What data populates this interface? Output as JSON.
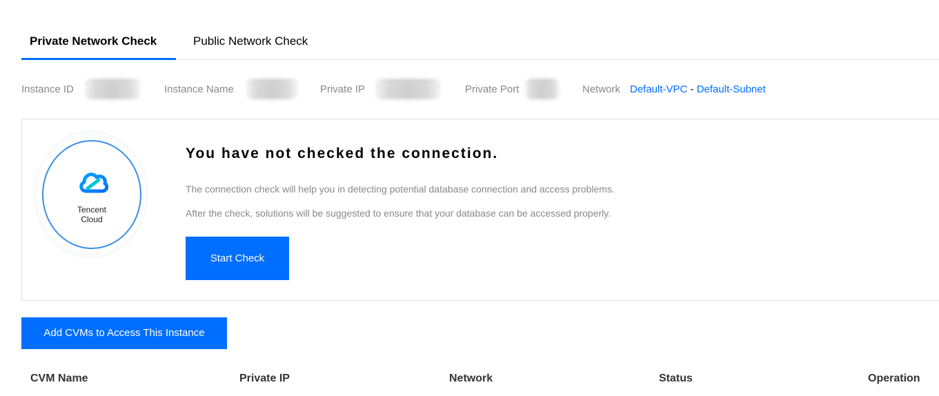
{
  "tabs": [
    {
      "label": "Private Network Check",
      "active": true
    },
    {
      "label": "Public Network Check",
      "active": false
    }
  ],
  "info": {
    "instance_id_label": "Instance ID",
    "instance_name_label": "Instance Name",
    "private_ip_label": "Private IP",
    "private_port_label": "Private Port",
    "network_label": "Network",
    "vpc": "Default-VPC",
    "separator": " - ",
    "subnet": "Default-Subnet"
  },
  "card": {
    "logo_text_line1": "Tencent",
    "logo_text_line2": "Cloud",
    "title": "You have not checked the connection.",
    "desc1": "The connection check will help you in detecting potential database connection and access problems.",
    "desc2": "After the check, solutions will be suggested to ensure that your database can be accessed properly.",
    "start_button": "Start Check"
  },
  "add_button": "Add CVMs to Access This Instance",
  "table": {
    "columns": [
      "CVM Name",
      "Private IP",
      "Network",
      "Status",
      "Operation"
    ]
  },
  "colors": {
    "accent": "#006eff",
    "muted_text": "#888888"
  },
  "icons": {
    "logo": "tencent-cloud-logo-icon"
  }
}
